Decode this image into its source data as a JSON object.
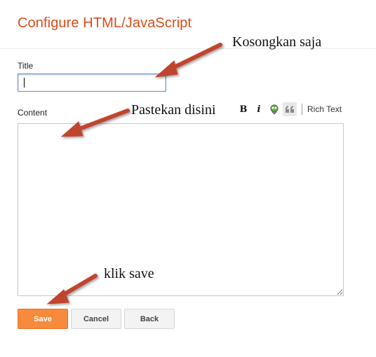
{
  "header": {
    "title": "Configure HTML/JavaScript"
  },
  "form": {
    "title_label": "Title",
    "title_value": "",
    "content_label": "Content",
    "content_value": "",
    "toolbar": {
      "bold_icon": "B",
      "italic_icon": "i",
      "rich_text_label": "Rich Text",
      "icons": [
        "bold-icon",
        "italic-icon",
        "link-icon",
        "quote-icon"
      ]
    }
  },
  "buttons": {
    "save": "Save",
    "cancel": "Cancel",
    "back": "Back"
  },
  "annotations": {
    "title_note": "Kosongkan saja",
    "content_note": "Pastekan disini",
    "save_note": "klik save"
  },
  "colors": {
    "accent": "#dd4b18",
    "save_button": "#f78a3b",
    "annotation_arrow": "#c0452e"
  }
}
